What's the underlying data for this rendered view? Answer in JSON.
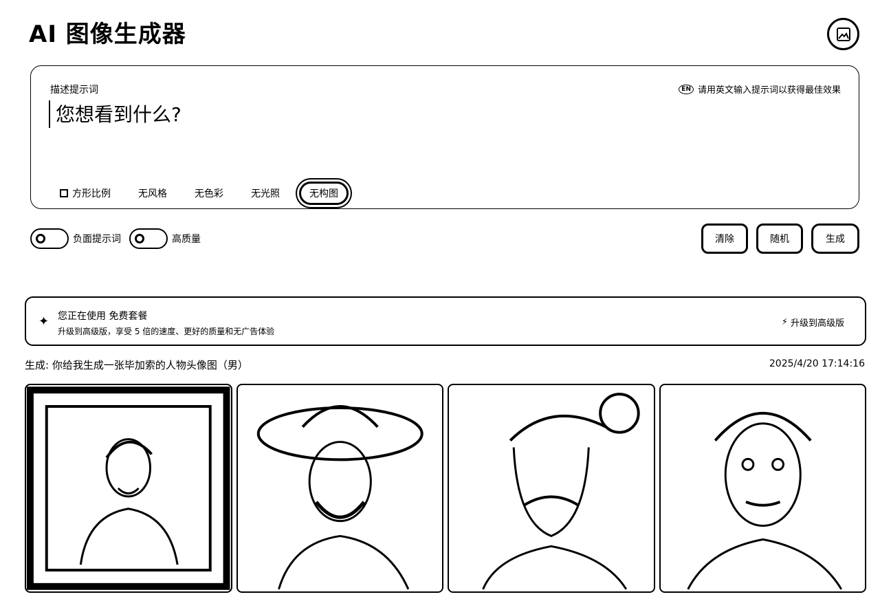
{
  "app": {
    "title": "AI 图像生成器"
  },
  "prompt": {
    "label": "描述提示词",
    "hint": "请用英文输入提示词以获得最佳效果",
    "hint_icon": "EN",
    "placeholder": "您想看到什么?",
    "value": ""
  },
  "options": [
    {
      "label": "方形比例",
      "icon": "square-icon"
    },
    {
      "label": "无风格"
    },
    {
      "label": "无色彩"
    },
    {
      "label": "无光照"
    },
    {
      "label": "无构图",
      "active": true
    }
  ],
  "toggles": [
    {
      "label": "负面提示词",
      "on": false
    },
    {
      "label": "高质量",
      "on": false
    }
  ],
  "actions": {
    "clear": "清除",
    "random": "随机",
    "generate": "生成"
  },
  "plan": {
    "title": "您正在使用 免费套餐",
    "description": "升级到高级版，享受 5 倍的速度、更好的质量和无广告体验",
    "upgrade": "升级到高级版"
  },
  "generation": {
    "title": "生成: 你给我生成一张毕加索的人物头像图（男）",
    "timestamp": "2025/4/20 17:14:16",
    "images": [
      {
        "name": "portrait-framed"
      },
      {
        "name": "portrait-hat"
      },
      {
        "name": "portrait-bun"
      },
      {
        "name": "portrait-gaunt"
      }
    ]
  }
}
